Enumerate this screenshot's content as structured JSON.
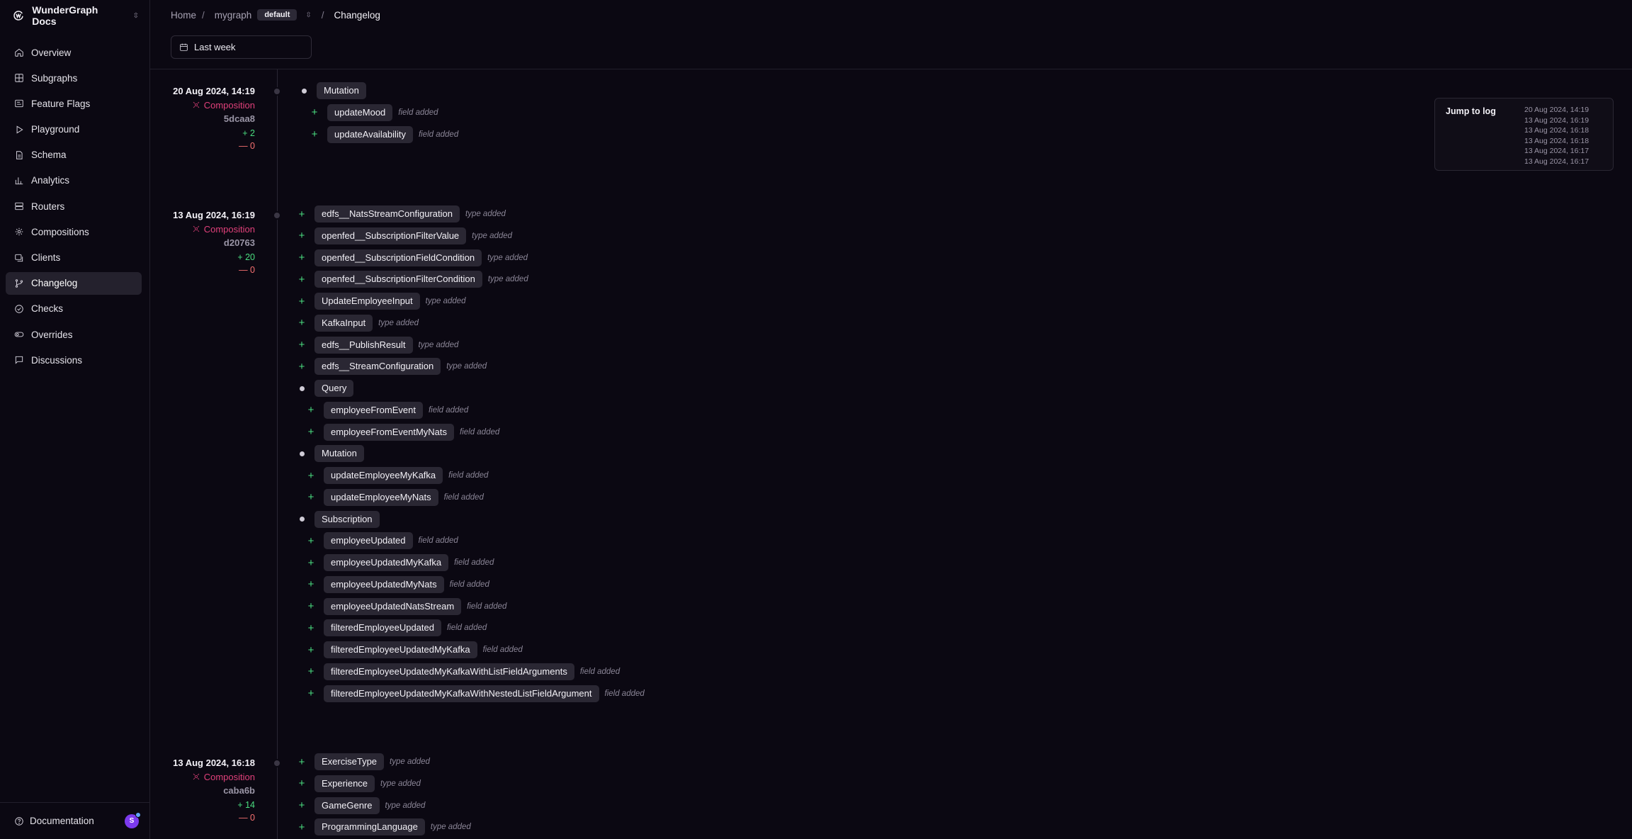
{
  "brand": {
    "name": "WunderGraph Docs"
  },
  "nav": [
    {
      "label": "Overview",
      "icon": "home-icon",
      "active": false
    },
    {
      "label": "Subgraphs",
      "icon": "grid-icon",
      "active": false
    },
    {
      "label": "Feature Flags",
      "icon": "feature-flag-icon",
      "active": false
    },
    {
      "label": "Playground",
      "icon": "play-icon",
      "active": false
    },
    {
      "label": "Schema",
      "icon": "file-icon",
      "active": false
    },
    {
      "label": "Analytics",
      "icon": "bar-chart-icon",
      "active": false
    },
    {
      "label": "Routers",
      "icon": "server-icon",
      "active": false
    },
    {
      "label": "Compositions",
      "icon": "layers-icon",
      "active": false
    },
    {
      "label": "Clients",
      "icon": "clients-icon",
      "active": false
    },
    {
      "label": "Changelog",
      "icon": "git-branch-icon",
      "active": true
    },
    {
      "label": "Checks",
      "icon": "check-circle-icon",
      "active": false
    },
    {
      "label": "Overrides",
      "icon": "toggle-icon",
      "active": false
    },
    {
      "label": "Discussions",
      "icon": "message-icon",
      "active": false
    }
  ],
  "footer": {
    "documentation": "Documentation",
    "avatar_letter": "S"
  },
  "breadcrumb": {
    "home": "Home",
    "separator": "/",
    "graph": "mygraph",
    "namespace": "default",
    "current": "Changelog"
  },
  "filter": {
    "date_range": "Last week"
  },
  "jump_to_log": {
    "title": "Jump to log",
    "items": [
      "20 Aug 2024, 14:19",
      "13 Aug 2024, 16:19",
      "13 Aug 2024, 16:18",
      "13 Aug 2024, 16:18",
      "13 Aug 2024, 16:17",
      "13 Aug 2024, 16:17"
    ]
  },
  "entries": [
    {
      "date": "20 Aug 2024, 14:19",
      "type": "Composition",
      "hash": "5dcaa8",
      "added": "+ 2",
      "removed": "— 0",
      "changes": [
        {
          "marker": "dot",
          "name": "Mutation",
          "kind": "",
          "indent": 1
        },
        {
          "marker": "plus",
          "name": "updateMood",
          "kind": "field added",
          "indent": 2
        },
        {
          "marker": "plus",
          "name": "updateAvailability",
          "kind": "field added",
          "indent": 2
        }
      ]
    },
    {
      "date": "13 Aug 2024, 16:19",
      "type": "Composition",
      "hash": "d20763",
      "added": "+ 20",
      "removed": "— 0",
      "changes": [
        {
          "marker": "plus",
          "name": "edfs__NatsStreamConfiguration",
          "kind": "type added",
          "indent": 1
        },
        {
          "marker": "plus",
          "name": "openfed__SubscriptionFilterValue",
          "kind": "type added",
          "indent": 1
        },
        {
          "marker": "plus",
          "name": "openfed__SubscriptionFieldCondition",
          "kind": "type added",
          "indent": 1
        },
        {
          "marker": "plus",
          "name": "openfed__SubscriptionFilterCondition",
          "kind": "type added",
          "indent": 1
        },
        {
          "marker": "plus",
          "name": "UpdateEmployeeInput",
          "kind": "type added",
          "indent": 1
        },
        {
          "marker": "plus",
          "name": "KafkaInput",
          "kind": "type added",
          "indent": 1
        },
        {
          "marker": "plus",
          "name": "edfs__PublishResult",
          "kind": "type added",
          "indent": 1
        },
        {
          "marker": "plus",
          "name": "edfs__StreamConfiguration",
          "kind": "type added",
          "indent": 1
        },
        {
          "marker": "dot",
          "name": "Query",
          "kind": "",
          "indent": 1
        },
        {
          "marker": "plus",
          "name": "employeeFromEvent",
          "kind": "field added",
          "indent": 2
        },
        {
          "marker": "plus",
          "name": "employeeFromEventMyNats",
          "kind": "field added",
          "indent": 2
        },
        {
          "marker": "dot",
          "name": "Mutation",
          "kind": "",
          "indent": 1
        },
        {
          "marker": "plus",
          "name": "updateEmployeeMyKafka",
          "kind": "field added",
          "indent": 2
        },
        {
          "marker": "plus",
          "name": "updateEmployeeMyNats",
          "kind": "field added",
          "indent": 2
        },
        {
          "marker": "dot",
          "name": "Subscription",
          "kind": "",
          "indent": 1
        },
        {
          "marker": "plus",
          "name": "employeeUpdated",
          "kind": "field added",
          "indent": 2
        },
        {
          "marker": "plus",
          "name": "employeeUpdatedMyKafka",
          "kind": "field added",
          "indent": 2
        },
        {
          "marker": "plus",
          "name": "employeeUpdatedMyNats",
          "kind": "field added",
          "indent": 2
        },
        {
          "marker": "plus",
          "name": "employeeUpdatedNatsStream",
          "kind": "field added",
          "indent": 2
        },
        {
          "marker": "plus",
          "name": "filteredEmployeeUpdated",
          "kind": "field added",
          "indent": 2
        },
        {
          "marker": "plus",
          "name": "filteredEmployeeUpdatedMyKafka",
          "kind": "field added",
          "indent": 2
        },
        {
          "marker": "plus",
          "name": "filteredEmployeeUpdatedMyKafkaWithListFieldArguments",
          "kind": "field added",
          "indent": 2
        },
        {
          "marker": "plus",
          "name": "filteredEmployeeUpdatedMyKafkaWithNestedListFieldArgument",
          "kind": "field added",
          "indent": 2
        }
      ]
    },
    {
      "date": "13 Aug 2024, 16:18",
      "type": "Composition",
      "hash": "caba6b",
      "added": "+ 14",
      "removed": "— 0",
      "changes": [
        {
          "marker": "plus",
          "name": "ExerciseType",
          "kind": "type added",
          "indent": 1
        },
        {
          "marker": "plus",
          "name": "Experience",
          "kind": "type added",
          "indent": 1
        },
        {
          "marker": "plus",
          "name": "GameGenre",
          "kind": "type added",
          "indent": 1
        },
        {
          "marker": "plus",
          "name": "ProgrammingLanguage",
          "kind": "type added",
          "indent": 1
        }
      ]
    }
  ]
}
